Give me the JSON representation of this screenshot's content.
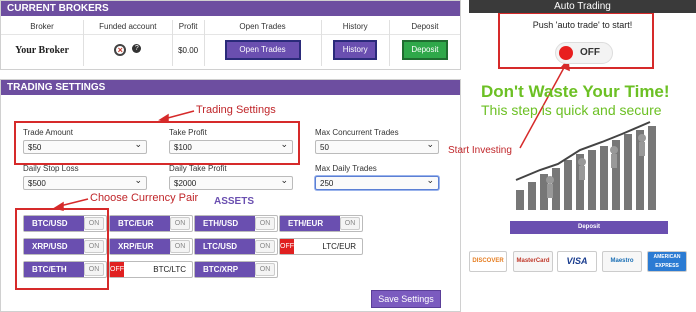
{
  "brokers": {
    "title": "CURRENT BROKERS",
    "columns": [
      "Broker",
      "Funded account",
      "Profit",
      "Open Trades",
      "History",
      "Deposit"
    ],
    "row": {
      "broker": "Your Broker",
      "profit": "$0.00",
      "open_trades": "Open Trades",
      "history": "History",
      "deposit": "Deposit"
    }
  },
  "settings": {
    "title": "TRADING SETTINGS",
    "fields": [
      {
        "label": "Trade Amount",
        "value": "$50"
      },
      {
        "label": "Take Profit",
        "value": "$100"
      },
      {
        "label": "Max Concurrent Trades",
        "value": "50"
      },
      {
        "label": "Daily Stop Loss",
        "value": "$500"
      },
      {
        "label": "Daily Take Profit",
        "value": "$2000"
      },
      {
        "label": "Max Daily Trades",
        "value": "250"
      }
    ],
    "assets_title": "ASSETS",
    "on_label": "ON",
    "off_label": "OFF",
    "assets": [
      "BTC/USD",
      "BTC/EUR",
      "ETH/USD",
      "ETH/EUR",
      "XRP/USD",
      "XRP/EUR",
      "LTC/USD",
      "LTC/EUR",
      "BTC/ETH",
      "BTC/LTC",
      "BTC/XRP"
    ],
    "save": "Save Settings"
  },
  "annotations": {
    "trading_settings": "Trading Settings",
    "currency_pair": "Choose Currency Pair",
    "start_investing": "Start Investing"
  },
  "auto": {
    "title": "Auto Trading",
    "push": "Push 'auto trade' to start!",
    "toggle": "OFF",
    "slogan1": "Don't Waste Your Time!",
    "slogan2": "This step is quick and secure",
    "deposit": "Deposit",
    "cards": [
      "DISCOVER",
      "MasterCard",
      "VISA",
      "Maestro",
      "AMERICAN EXPRESS"
    ]
  },
  "colors": {
    "purple": "#6a4fb0",
    "green": "#2fa84a",
    "red": "#d62a2a",
    "slogan": "#6cc024"
  }
}
